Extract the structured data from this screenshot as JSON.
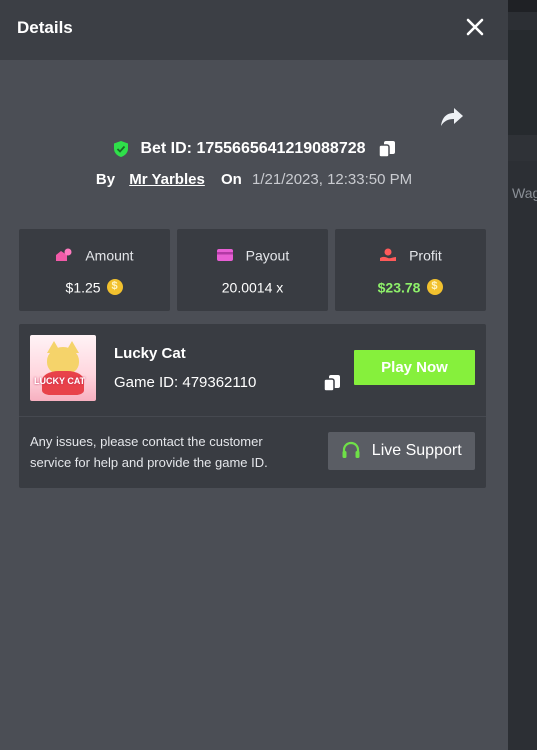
{
  "modal": {
    "title": "Details",
    "close_icon": "close-icon",
    "share_icon": "share-icon"
  },
  "bet": {
    "id_label": "Bet ID: 1755665641219088728",
    "by_label": "By",
    "user": "Mr Yarbles",
    "on_label": "On",
    "datetime": "1/21/2023, 12:33:50 PM"
  },
  "stats": [
    {
      "label": "Amount",
      "value": "$1.25",
      "icon": "amount-icon"
    },
    {
      "label": "Payout",
      "value": "20.0014 x",
      "icon": "payout-icon"
    },
    {
      "label": "Profit",
      "value": "$23.78",
      "icon": "profit-icon"
    }
  ],
  "game": {
    "name": "Lucky Cat",
    "id_label": "Game ID: 479362110",
    "thumb_text": "LUCKY CAT",
    "play_label": "Play Now",
    "help_text": "Any issues, please contact the customer service for help and provide the game ID.",
    "support_label": "Live Support"
  },
  "background": {
    "partial_text": "Wag"
  },
  "colors": {
    "accent_green": "#86f03c",
    "profit_green": "#8ef06a",
    "coin": "#f2c12e",
    "amount_pink": "#f25aa8",
    "payout_pink": "#e85fd4",
    "profit_red": "#ff5a5a"
  }
}
